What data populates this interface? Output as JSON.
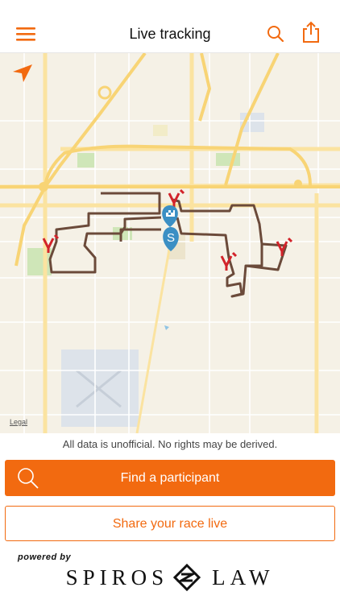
{
  "header": {
    "title": "Live tracking",
    "accent_color": "#f26a10",
    "icons": [
      "hamburger-menu-icon",
      "search-icon",
      "share-icon"
    ]
  },
  "map": {
    "legal_label": "Legal",
    "route_color": "#6b4a3a",
    "markers": [
      "aid-station-marker",
      "finish-flag-marker",
      "start-marker"
    ],
    "start_label": "S"
  },
  "disclaimer": "All data is unofficial. No rights may be derived.",
  "buttons": {
    "find_participant": "Find a participant",
    "share_race": "Share your race live"
  },
  "footer": {
    "powered_by": "powered by",
    "sponsor_left": "SPIROS",
    "sponsor_right": "LAW"
  }
}
